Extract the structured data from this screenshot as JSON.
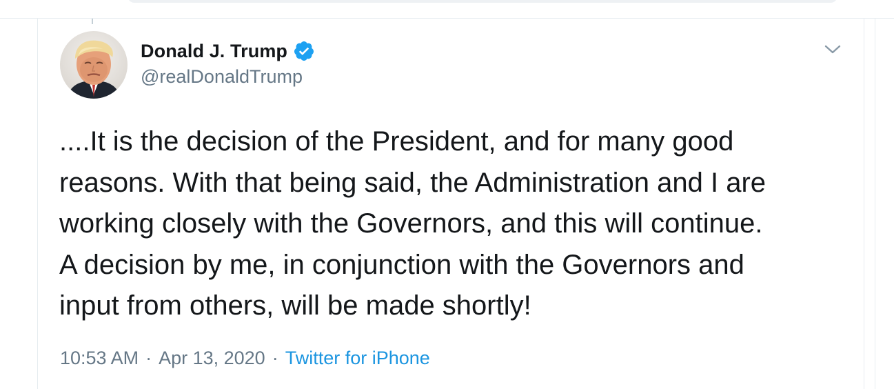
{
  "tweet": {
    "display_name": "Donald J. Trump",
    "handle": "@realDonaldTrump",
    "verified": true,
    "text_lines": [
      "....It is the decision of the President, and for many good",
      "reasons. With that being said, the Administration and I are",
      "working closely with the Governors, and this will continue.",
      "A decision by me, in conjunction with the Governors and",
      "input from others, will be made shortly!"
    ],
    "time": "10:53 AM",
    "separator": "·",
    "date": "Apr 13, 2020",
    "source": "Twitter for iPhone"
  },
  "icons": {
    "verified": "verified-badge-icon",
    "menu": "chevron-down-icon",
    "avatar": "profile-photo"
  },
  "colors": {
    "text_primary": "#14171a",
    "text_secondary": "#657786",
    "link": "#1b95e0",
    "verified_badge": "#1da1f2",
    "divider": "#e6ecf0"
  }
}
